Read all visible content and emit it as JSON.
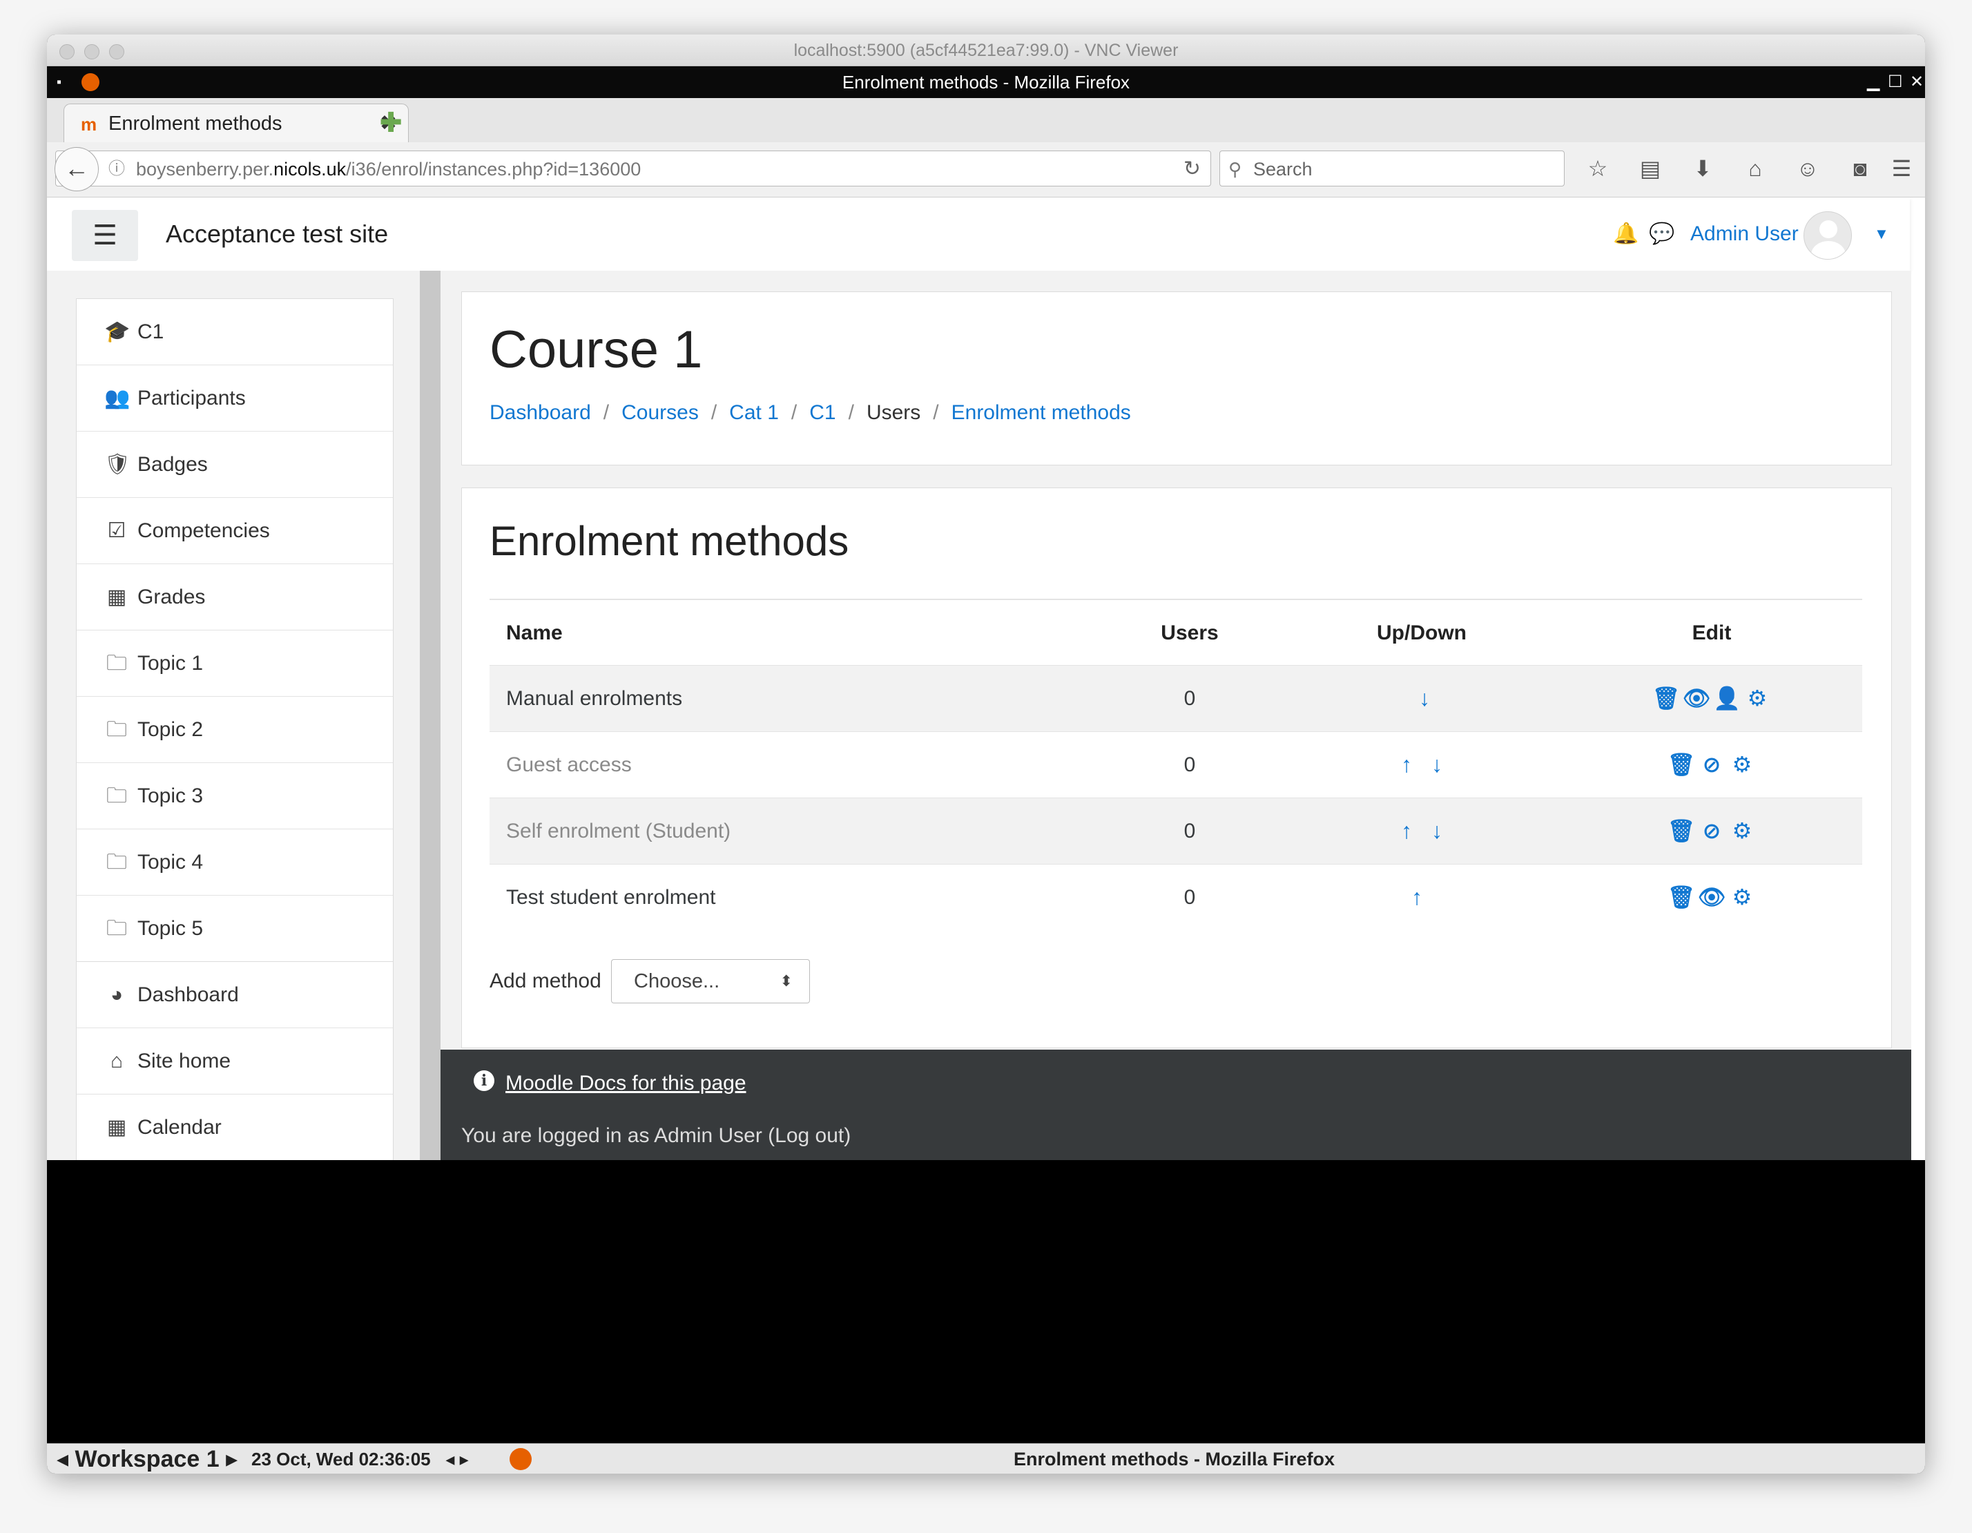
{
  "vnc": {
    "title": "localhost:5900 (a5cf44521ea7:99.0) - VNC Viewer"
  },
  "firefox": {
    "window_title": "Enrolment methods - Mozilla Firefox",
    "tab_label": "Enrolment methods",
    "url_prefix": "boysenberry.per.",
    "url_domain": "nicols.uk",
    "url_path": "/i36/enrol/instances.php?id=136000",
    "search_placeholder": "Search"
  },
  "moodle": {
    "site_name": "Acceptance test site",
    "user_name": "Admin User",
    "nav_course": [
      {
        "icon": "graduation-cap-icon",
        "glyph": "🎓",
        "label": "C1"
      },
      {
        "icon": "users-icon",
        "glyph": "👥",
        "label": "Participants"
      },
      {
        "icon": "shield-icon",
        "glyph": "🛡",
        "label": "Badges"
      },
      {
        "icon": "check-square-icon",
        "glyph": "☑",
        "label": "Competencies"
      },
      {
        "icon": "table-icon",
        "glyph": "▦",
        "label": "Grades"
      },
      {
        "icon": "folder-icon",
        "glyph": "🗀",
        "label": "Topic 1"
      },
      {
        "icon": "folder-icon",
        "glyph": "🗀",
        "label": "Topic 2"
      },
      {
        "icon": "folder-icon",
        "glyph": "🗀",
        "label": "Topic 3"
      },
      {
        "icon": "folder-icon",
        "glyph": "🗀",
        "label": "Topic 4"
      },
      {
        "icon": "folder-icon",
        "glyph": "🗀",
        "label": "Topic 5"
      }
    ],
    "nav_site": [
      {
        "icon": "dashboard-icon",
        "glyph": "◕",
        "label": "Dashboard"
      },
      {
        "icon": "home-icon",
        "glyph": "⌂",
        "label": "Site home"
      },
      {
        "icon": "calendar-icon",
        "glyph": "▦",
        "label": "Calendar"
      }
    ],
    "course_title": "Course 1",
    "breadcrumb": [
      "Dashboard",
      "Courses",
      "Cat 1",
      "C1",
      "Users",
      "Enrolment methods"
    ],
    "heading": "Enrolment methods",
    "table": {
      "headers": {
        "name": "Name",
        "users": "Users",
        "updown": "Up/Down",
        "edit": "Edit"
      },
      "rows": [
        {
          "name": "Manual enrolments",
          "users": "0"
        },
        {
          "name": "Guest access",
          "users": "0"
        },
        {
          "name": "Self enrolment (Student)",
          "users": "0"
        },
        {
          "name": "Test student enrolment",
          "users": "0"
        }
      ]
    },
    "add_method_label": "Add method",
    "add_method_value": "Choose...",
    "footer_docs": "Moodle Docs for this page",
    "footer_logged_in": "You are logged in as Admin User (Log out)"
  },
  "taskbar": {
    "workspace": "Workspace 1",
    "clock": "23 Oct, Wed 02:36:05",
    "window_title": "Enrolment methods - Mozilla Firefox"
  }
}
